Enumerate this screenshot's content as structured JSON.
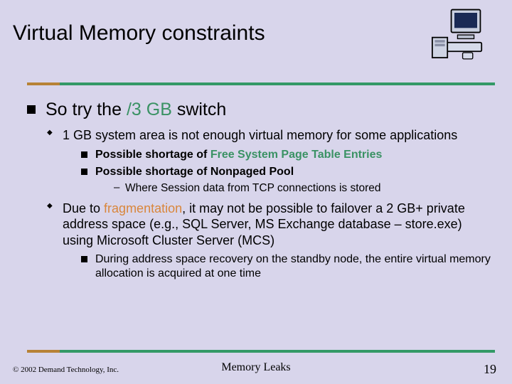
{
  "title": "Virtual Memory constraints",
  "clip_alt": "retro computer clipart",
  "main": {
    "heading_pre": "So try the ",
    "heading_em": "/3 GB",
    "heading_post": " switch",
    "sub1": "1 GB system area is not enough virtual memory for some applications",
    "sub1_a_pre": "Possible shortage of ",
    "sub1_a_em": "Free System Page Table Entries",
    "sub1_b": "Possible shortage of Nonpaged Pool",
    "sub1_b_i": "Where Session data from TCP connections is stored",
    "sub2_pre": "Due to ",
    "sub2_em": "fragmentation",
    "sub2_post": ", it may not be possible to failover a 2 GB+ private address space (e.g., SQL Server, MS Exchange database – store.exe) using Microsoft Cluster Server (MCS)",
    "sub2_a": "During address space recovery on the standby node, the entire virtual memory allocation is acquired at one time"
  },
  "footer": {
    "copyright": "© 2002 Demand Technology, Inc.",
    "center": "Memory Leaks",
    "page": "19"
  }
}
